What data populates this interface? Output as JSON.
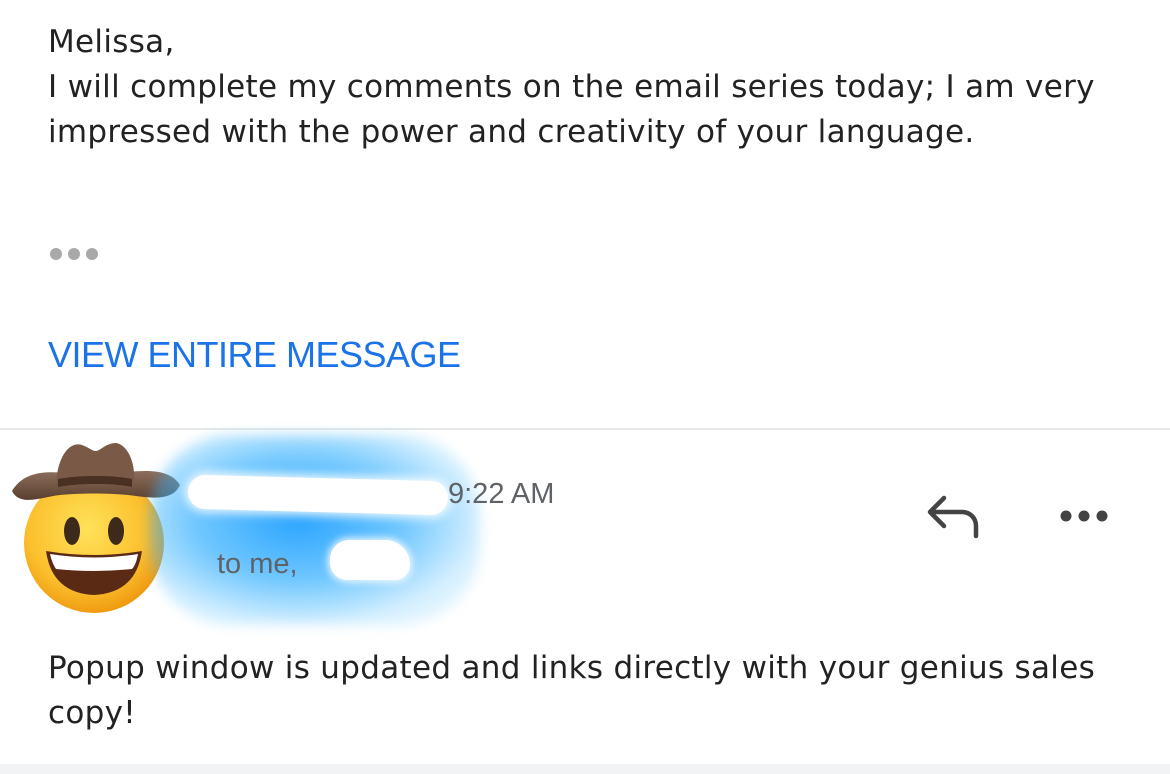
{
  "previous_message": {
    "lines": [
      "Melissa,",
      "I will complete my comments on the email series today; I am very impressed with the power and creativity of your language."
    ],
    "trimmed_icon": "ellipsis-icon",
    "view_entire_label": "VIEW ENTIRE MESSAGE"
  },
  "message": {
    "avatar_icon": "cowboy-hat-face-emoji",
    "time": "9:22 AM",
    "recipients": "to me,",
    "reply_icon": "reply-icon",
    "more_icon": "more-options-icon",
    "body": "Popup window is updated and links directly with your genius sales copy!"
  },
  "colors": {
    "link": "#1a73e8",
    "text": "#222222",
    "secondary_text": "#5f6368",
    "redaction_glow": "#20a0ff"
  }
}
